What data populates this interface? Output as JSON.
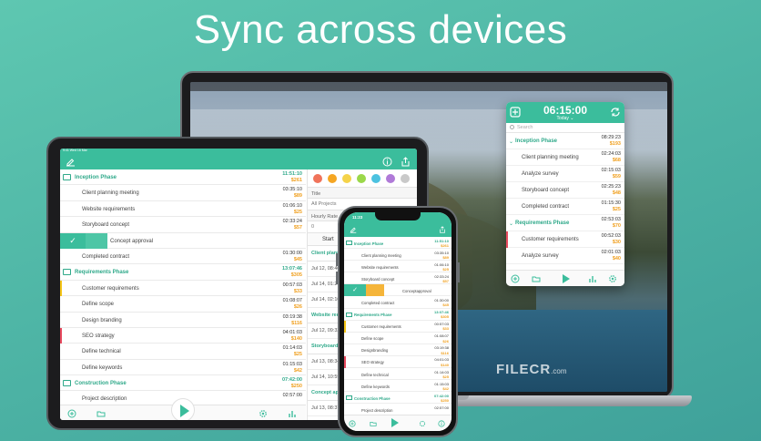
{
  "hero": {
    "title": "Sync across devices"
  },
  "colors": {
    "accent": "#3bbd9c",
    "money": "#f0a020",
    "phase": "#2fa98a"
  },
  "watermark": {
    "text": "FILECR",
    "sub": ".com"
  },
  "mac": {
    "timer": "06:15:00",
    "today": "Today ⌄",
    "search_placeholder": "Search",
    "rows": [
      {
        "type": "phase",
        "label": "Inception Phase",
        "time": "08:29:23",
        "money": "$193"
      },
      {
        "type": "task",
        "label": "Client planning meeting",
        "time": "02:24:03",
        "money": "$68"
      },
      {
        "type": "task",
        "label": "Analyze survey",
        "time": "02:15:03",
        "money": "$59"
      },
      {
        "type": "task",
        "label": "Storyboard concept",
        "time": "02:25:23",
        "money": "$48"
      },
      {
        "type": "task",
        "label": "Completed contract",
        "time": "01:15:30",
        "money": "$25"
      },
      {
        "type": "phase",
        "label": "Requirements Phase",
        "time": "02:53:03",
        "money": "$70"
      },
      {
        "type": "task",
        "label": "Customer requirements",
        "time": "00:52:03",
        "money": "$30",
        "flag": "#e84a5f"
      },
      {
        "type": "task",
        "label": "Analyze survey",
        "time": "02:01:03",
        "money": "$40"
      }
    ],
    "toolbar_icons": [
      "add-category-icon",
      "folder-icon",
      "play-icon",
      "stats-icon",
      "settings-icon"
    ]
  },
  "tablet": {
    "status_text": "9:41 Wed 16 Mar",
    "header_icons": [
      "edit-icon",
      "info-icon",
      "export-icon"
    ],
    "rows": [
      {
        "type": "phase",
        "label": "Inception Phase",
        "time": "11:51:10",
        "money": "$261"
      },
      {
        "type": "task",
        "label": "Client planning meeting",
        "time": "03:35:10",
        "money": "$89"
      },
      {
        "type": "task",
        "label": "Website requirements",
        "time": "01:06:10",
        "money": "$25"
      },
      {
        "type": "task",
        "label": "Storyboard concept",
        "time": "02:33:24",
        "money": "$57"
      },
      {
        "type": "swiped",
        "label": "Concept approval",
        "time": "",
        "money": ""
      },
      {
        "type": "task",
        "label": "Completed contract",
        "time": "01:30:00",
        "money": "$45"
      },
      {
        "type": "phase",
        "label": "Requirements Phase",
        "time": "13:07:46",
        "money": "$305"
      },
      {
        "type": "task",
        "label": "Customer requirements",
        "time": "00:57:03",
        "money": "$33",
        "flag": "#f5c518"
      },
      {
        "type": "task",
        "label": "Define scope",
        "time": "01:08:07",
        "money": "$26"
      },
      {
        "type": "task",
        "label": "Design branding",
        "time": "03:19:38",
        "money": "$116"
      },
      {
        "type": "task",
        "label": "SEO strategy",
        "time": "04:01:03",
        "money": "$140",
        "flag": "#e84a5f"
      },
      {
        "type": "task",
        "label": "Define technical",
        "time": "01:14:03",
        "money": "$25"
      },
      {
        "type": "task",
        "label": "Define keywords",
        "time": "01:15:03",
        "money": "$42"
      },
      {
        "type": "phase",
        "label": "Construction Phase",
        "time": "07:42:00",
        "money": "$250"
      },
      {
        "type": "task",
        "label": "Project description",
        "time": "02:57:00",
        "money": ""
      }
    ],
    "detail": {
      "colors": [
        "#f0735a",
        "#f5a623",
        "#f5d34a",
        "#9bd84a",
        "#4cc2e0",
        "#b07ad8",
        "#c9c9c9"
      ],
      "title_label": "Title",
      "project_value": "All Projects",
      "rate_label": "Hourly Rate",
      "rate_value": "0",
      "start_label": "Start",
      "sections": [
        {
          "header": "Client plann",
          "items": [
            "Jul 12, 08:40",
            "Jul 14, 01:26",
            "Jul 14, 02:10"
          ]
        },
        {
          "header": "Website requ",
          "items": [
            "Jul 12, 09:32"
          ]
        },
        {
          "header": "Storyboard c",
          "items": [
            "Jul 13, 08:34",
            "Jul 14, 10:59"
          ]
        },
        {
          "header": "Concept app",
          "items": [
            "Jul 13, 08:37",
            "Jul 14, 11:50"
          ]
        }
      ]
    },
    "toolbar_icons": [
      "add-category-icon",
      "folder-icon",
      "play-icon",
      "settings-icon",
      "stats-icon"
    ]
  },
  "phone": {
    "time": "11:23",
    "rows": [
      {
        "type": "phase",
        "label": "Inception Phase",
        "time": "11:51:10",
        "money": "$261"
      },
      {
        "type": "task",
        "label": "Client planning meeting",
        "time": "03:35:10",
        "money": "$89"
      },
      {
        "type": "task",
        "label": "Website requirements",
        "time": "01:06:10",
        "money": "$25"
      },
      {
        "type": "task",
        "label": "Storyboard concept",
        "time": "02:33:24",
        "money": "$57"
      },
      {
        "type": "swiped",
        "label": "Conceptapproval",
        "time": "",
        "money": ""
      },
      {
        "type": "task",
        "label": "Completed contract",
        "time": "01:30:00",
        "money": "$45"
      },
      {
        "type": "phase",
        "label": "Requirements Phase",
        "time": "13:07:46",
        "money": "$305"
      },
      {
        "type": "task",
        "label": "Customer requirements",
        "time": "00:57:03",
        "money": "$33",
        "flag": "#f5c518"
      },
      {
        "type": "task",
        "label": "Define scope",
        "time": "01:08:07",
        "money": "$26"
      },
      {
        "type": "task",
        "label": "Designbranding",
        "time": "03:19:38",
        "money": "$116"
      },
      {
        "type": "task",
        "label": "SEO strategy",
        "time": "04:01:03",
        "money": "$140",
        "flag": "#e84a5f"
      },
      {
        "type": "task",
        "label": "Define technical",
        "time": "01:14:03",
        "money": "$25"
      },
      {
        "type": "task",
        "label": "Define keywords",
        "time": "01:15:03",
        "money": "$42"
      },
      {
        "type": "phase",
        "label": "Construction Phase",
        "time": "07:42:00",
        "money": "$250"
      },
      {
        "type": "task",
        "label": "Project description",
        "time": "02:57:00",
        "money": ""
      }
    ]
  }
}
